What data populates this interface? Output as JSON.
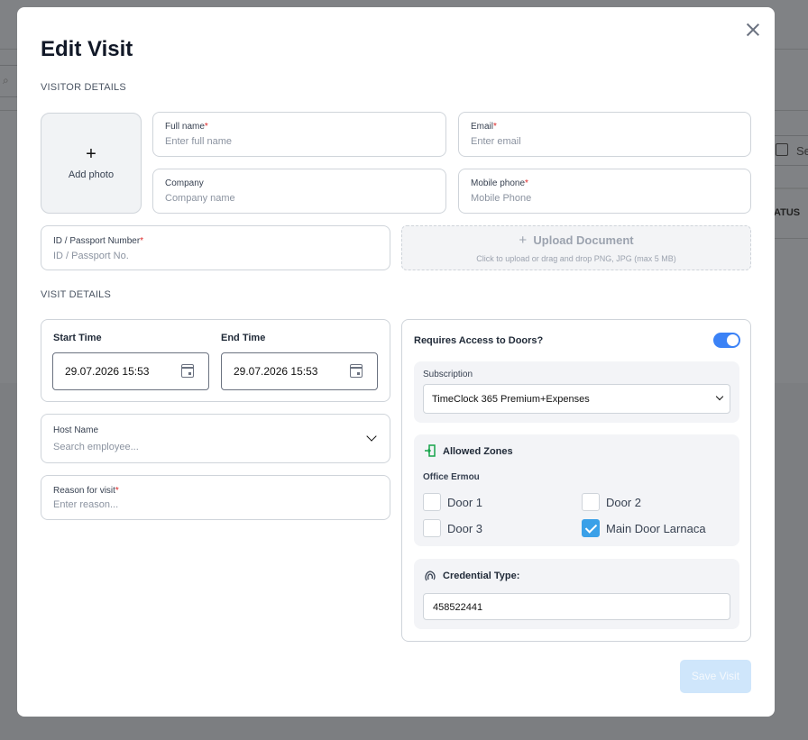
{
  "background": {
    "search_icon": "magnifier-chevron-icon",
    "date_label": "Se",
    "status_header": "ATUS"
  },
  "modal": {
    "title": "Edit Visit",
    "close_icon": "close-icon"
  },
  "visitor_details": {
    "section_label": "VISITOR DETAILS",
    "photo": {
      "plus": "+",
      "label": "Add photo"
    },
    "full_name": {
      "label": "Full name",
      "required": "*",
      "placeholder": "Enter full name"
    },
    "email": {
      "label": "Email",
      "required": "*",
      "placeholder": "Enter email"
    },
    "company": {
      "label": "Company",
      "placeholder": "Company name"
    },
    "mobile_phone": {
      "label": "Mobile phone",
      "required": "*",
      "placeholder": "Mobile Phone"
    },
    "id_passport": {
      "label": "ID / Passport Number",
      "required": "*",
      "placeholder": "ID / Passport No."
    },
    "upload": {
      "title": "Upload Document",
      "plus": "+",
      "subtitle": "Click to upload or drag and drop PNG, JPG (max 5 MB)"
    }
  },
  "visit_details": {
    "section_label": "VISIT DETAILS",
    "start_time": {
      "label": "Start Time",
      "value": "29.07.2026 15:53"
    },
    "end_time": {
      "label": "End Time",
      "value": "29.07.2026 15:53"
    },
    "host_name": {
      "label": "Host Name",
      "placeholder": "Search employee..."
    },
    "reason": {
      "label": "Reason for visit",
      "required": "*",
      "placeholder": "Enter reason..."
    }
  },
  "access": {
    "requires_label": "Requires Access to Doors?",
    "toggle_on": true,
    "subscription": {
      "label": "Subscription",
      "value": "TimeClock 365 Premium+Expenses"
    },
    "allowed_zones": {
      "title": "Allowed Zones",
      "icon": "door-enter-icon",
      "zone_name": "Office Ermou",
      "doors": [
        {
          "label": "Door 1",
          "checked": false
        },
        {
          "label": "Door 2",
          "checked": false
        },
        {
          "label": "Door 3",
          "checked": false
        },
        {
          "label": "Main Door Larnaca",
          "checked": true
        }
      ]
    },
    "credential": {
      "title": "Credential Type:",
      "icon": "fingerprint-icon",
      "value": "458522441"
    }
  },
  "footer": {
    "save_label": "Save Visit"
  },
  "colors": {
    "accent": "#3b82f6",
    "checkbox_checked": "#3aa0e8",
    "save_disabled_bg": "#cfe6fb",
    "required": "#dc2626"
  }
}
